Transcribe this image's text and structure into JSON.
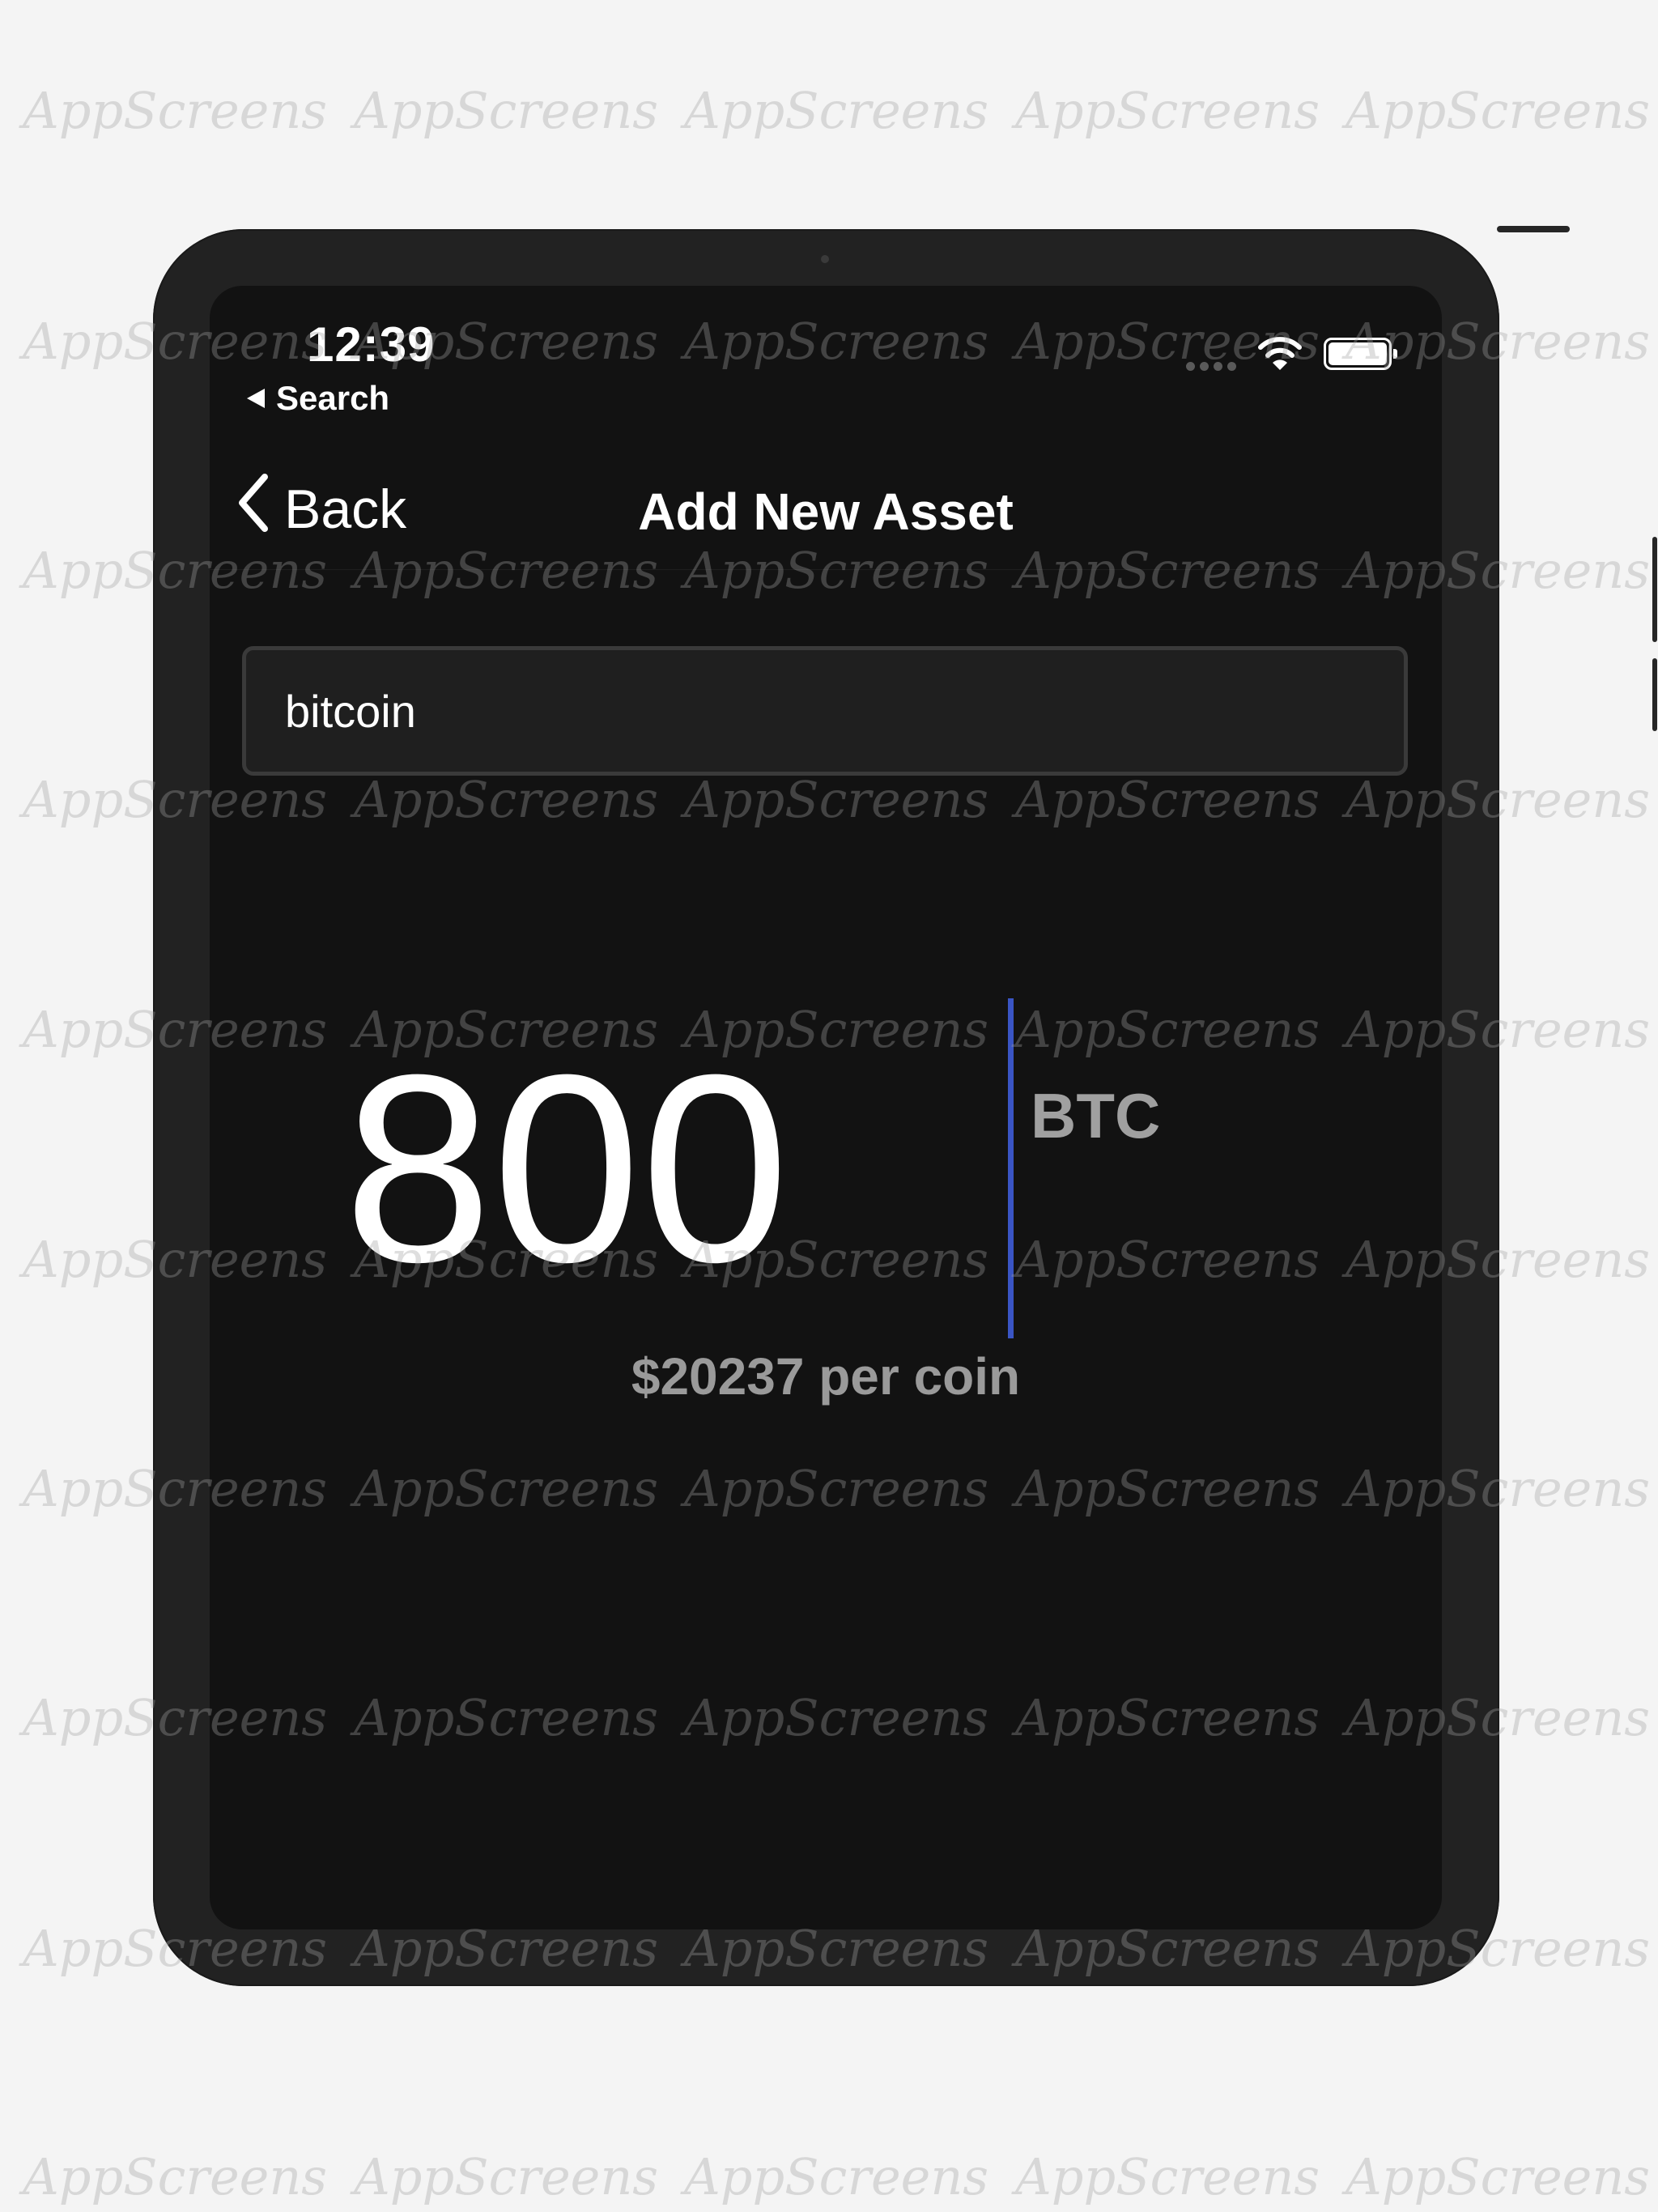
{
  "status_bar": {
    "time": "12:39",
    "back_app": "Search"
  },
  "nav": {
    "back_label": "Back",
    "title": "Add New Asset"
  },
  "search": {
    "value": "bitcoin"
  },
  "amount": {
    "value": "800",
    "unit": "BTC",
    "price_per_coin": "$20237 per coin"
  },
  "watermark": {
    "text": "AppScreens"
  },
  "colors": {
    "background": "#f4f4f4",
    "screen": "#121212",
    "caret": "#3a55c4"
  },
  "icons": [
    "chevron-left-icon",
    "wifi-icon",
    "battery-icon",
    "cellular-dots-icon",
    "back-triangle-icon"
  ]
}
